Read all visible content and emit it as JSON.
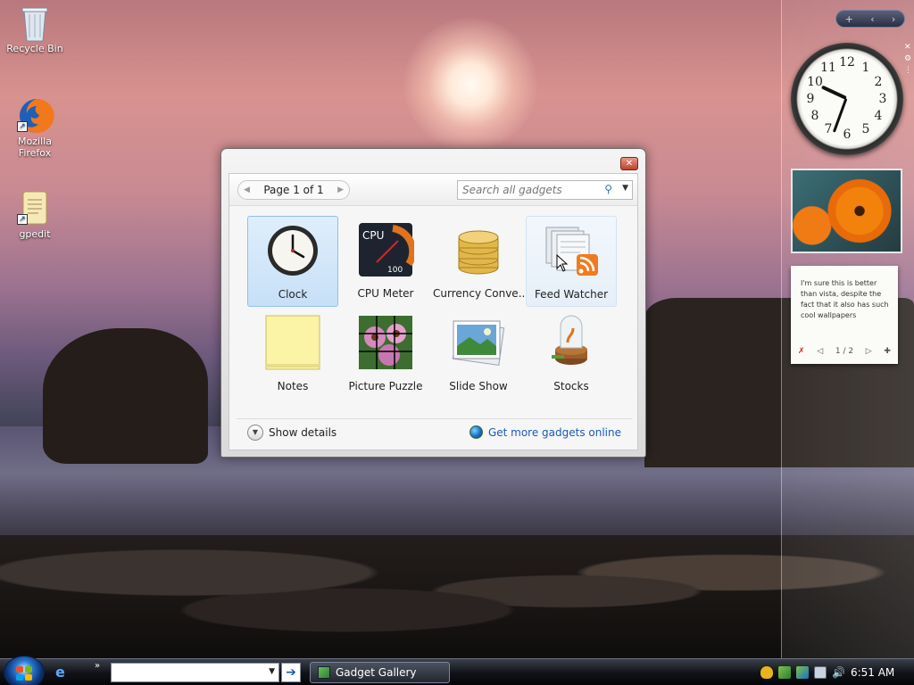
{
  "desktop": {
    "icons": [
      {
        "label": "Recycle Bin"
      },
      {
        "label": "Mozilla Firefox"
      },
      {
        "label": "gpedit"
      }
    ]
  },
  "sidebar": {
    "controls": [
      "+",
      "‹",
      "›"
    ],
    "note": {
      "text": "I'm sure this is better than vista, despite the fact that it also has such cool wallpapers",
      "page": "1 / 2"
    }
  },
  "gallery": {
    "pager": "Page 1 of 1",
    "search_placeholder": "Search all gadgets",
    "gadgets": [
      {
        "label": "Clock",
        "icon": "clock-icon"
      },
      {
        "label": "CPU Meter",
        "icon": "cpu-meter-icon"
      },
      {
        "label": "Currency Conve...",
        "icon": "currency-icon"
      },
      {
        "label": "Feed Watcher",
        "icon": "feed-watcher-icon"
      },
      {
        "label": "Notes",
        "icon": "notes-icon"
      },
      {
        "label": "Picture Puzzle",
        "icon": "picture-puzzle-icon"
      },
      {
        "label": "Slide Show",
        "icon": "slide-show-icon"
      },
      {
        "label": "Stocks",
        "icon": "stocks-icon"
      }
    ],
    "show_details": "Show details",
    "get_more": "Get more gadgets online"
  },
  "taskbar": {
    "task_label": "Gadget Gallery",
    "time": "6:51 AM"
  },
  "colors": {
    "selection": "#c7e0f7",
    "link": "#1c59b8"
  }
}
